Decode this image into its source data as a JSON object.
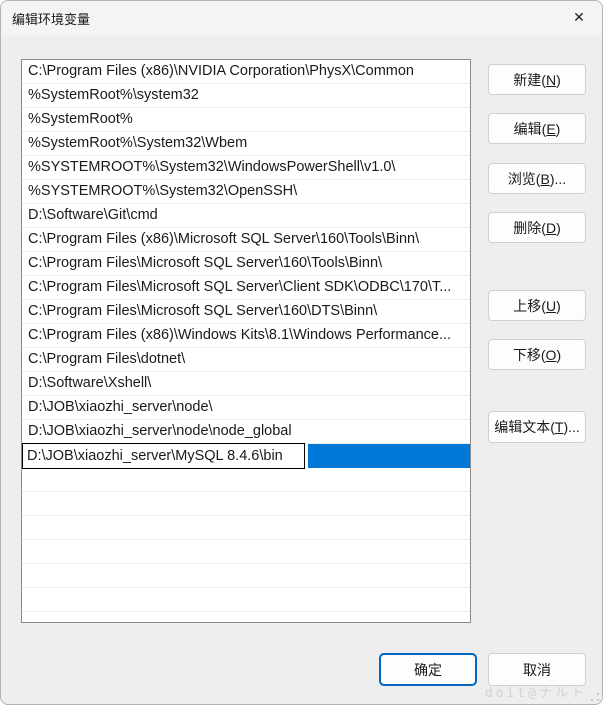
{
  "window": {
    "title": "编辑环境变量",
    "close_glyph": "✕"
  },
  "list": {
    "items": [
      "C:\\Program Files (x86)\\NVIDIA Corporation\\PhysX\\Common",
      "%SystemRoot%\\system32",
      "%SystemRoot%",
      "%SystemRoot%\\System32\\Wbem",
      "%SYSTEMROOT%\\System32\\WindowsPowerShell\\v1.0\\",
      "%SYSTEMROOT%\\System32\\OpenSSH\\",
      "D:\\Software\\Git\\cmd",
      "C:\\Program Files (x86)\\Microsoft SQL Server\\160\\Tools\\Binn\\",
      "C:\\Program Files\\Microsoft SQL Server\\160\\Tools\\Binn\\",
      "C:\\Program Files\\Microsoft SQL Server\\Client SDK\\ODBC\\170\\T...",
      "C:\\Program Files\\Microsoft SQL Server\\160\\DTS\\Binn\\",
      "C:\\Program Files (x86)\\Windows Kits\\8.1\\Windows Performance...",
      "C:\\Program Files\\dotnet\\",
      "D:\\Software\\Xshell\\",
      "D:\\JOB\\xiaozhi_server\\node\\",
      "D:\\JOB\\xiaozhi_server\\node\\node_global"
    ],
    "edit_value": "D:\\JOB\\xiaozhi_server\\MySQL 8.4.6\\bin",
    "selected_index": 16
  },
  "side_buttons": [
    {
      "pre": "新建(",
      "key": "N",
      "suf": ")"
    },
    {
      "pre": "编辑(",
      "key": "E",
      "suf": ")"
    },
    {
      "pre": "浏览(",
      "key": "B",
      "suf": ")..."
    },
    {
      "pre": "删除(",
      "key": "D",
      "suf": ")"
    },
    {
      "pre": "上移(",
      "key": "U",
      "suf": ")"
    },
    {
      "pre": "下移(",
      "key": "O",
      "suf": ")"
    },
    {
      "pre": "编辑文本(",
      "key": "T",
      "suf": ")..."
    }
  ],
  "footer": {
    "ok_label": "确定",
    "cancel_label": "取消"
  },
  "watermark": {
    "text": "doit@ナルト"
  },
  "colors": {
    "selection_blue": "#0078d7",
    "default_button_border": "#0067c0"
  }
}
